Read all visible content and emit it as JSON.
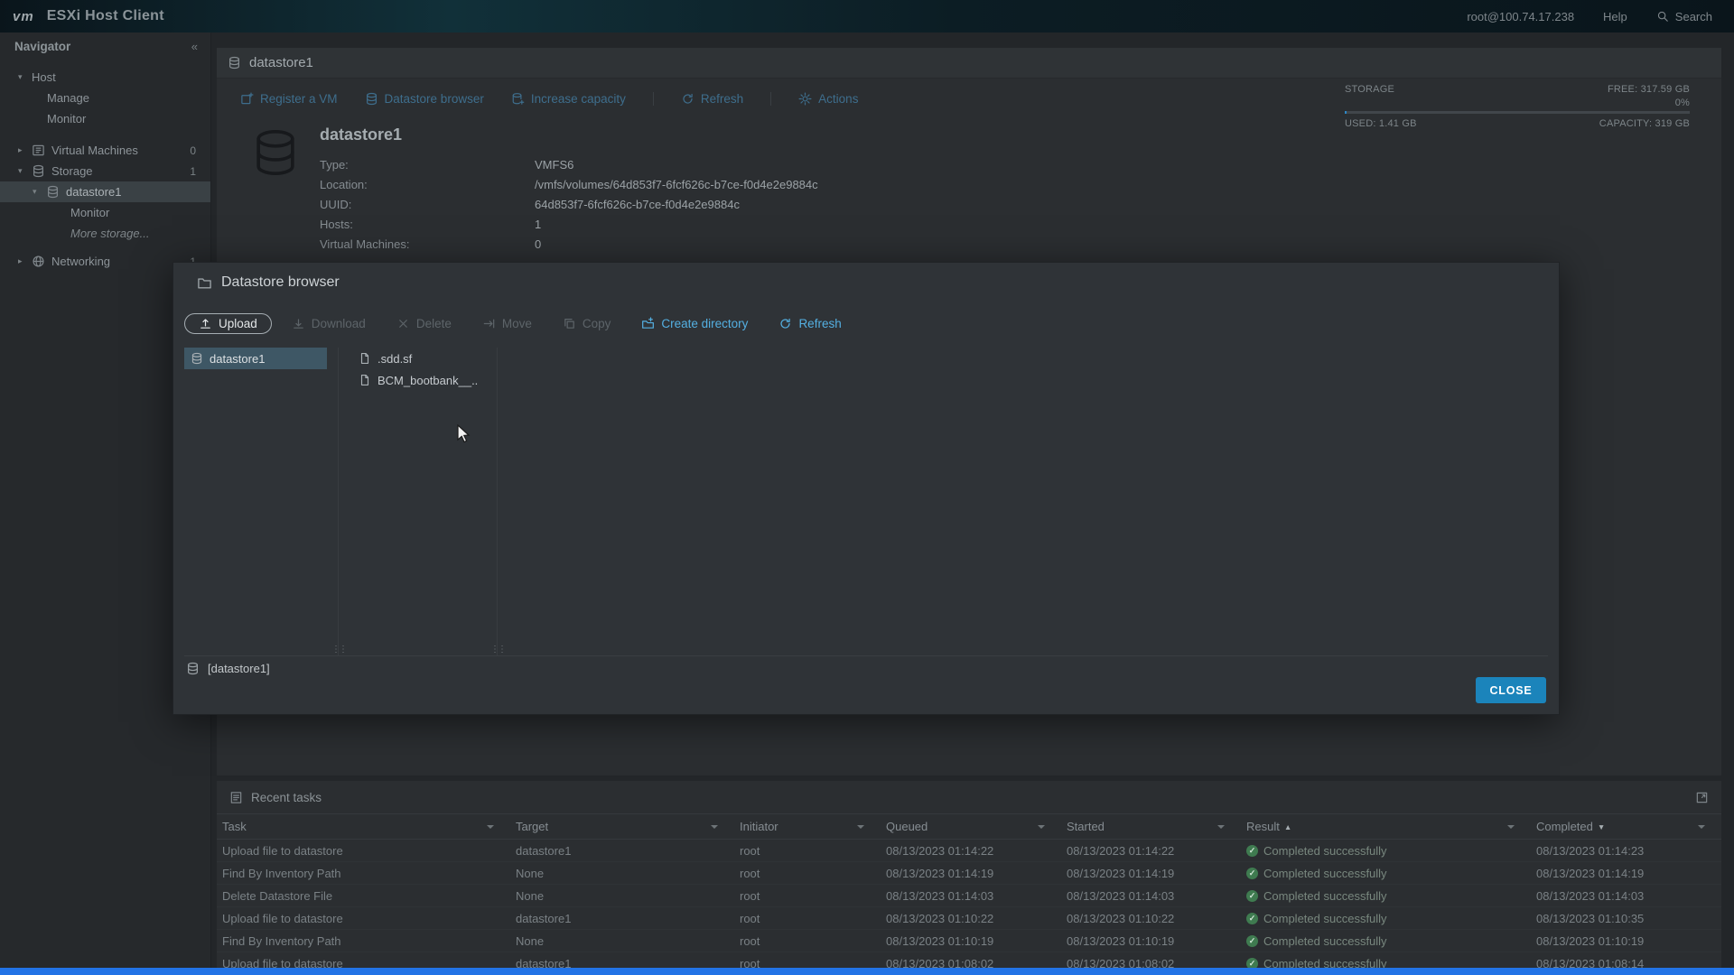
{
  "topbar": {
    "logo": "vm",
    "title": "ESXi Host Client",
    "user": "root@100.74.17.238",
    "help": "Help",
    "search": "Search"
  },
  "sidebar": {
    "header": "Navigator",
    "host": "Host",
    "manage": "Manage",
    "monitor": "Monitor",
    "virtual_machines": "Virtual Machines",
    "vm_count": "0",
    "storage": "Storage",
    "storage_count": "1",
    "datastore1": "datastore1",
    "datastore_monitor": "Monitor",
    "more_storage": "More storage...",
    "networking": "Networking",
    "networking_count": "1"
  },
  "main": {
    "title": "datastore1",
    "toolbar": {
      "register_vm": "Register a VM",
      "datastore_browser": "Datastore browser",
      "increase_capacity": "Increase capacity",
      "refresh": "Refresh",
      "actions": "Actions"
    },
    "storage_widget": {
      "label": "STORAGE",
      "free": "FREE: 317.59 GB",
      "percent": "0%",
      "used": "USED: 1.41 GB",
      "capacity": "CAPACITY: 319 GB"
    },
    "details": {
      "name": "datastore1",
      "type_label": "Type:",
      "type": "VMFS6",
      "location_label": "Location:",
      "location": "/vmfs/volumes/64d853f7-6fcf626c-b7ce-f0d4e2e9884c",
      "uuid_label": "UUID:",
      "uuid": "64d853f7-6fcf626c-b7ce-f0d4e2e9884c",
      "hosts_label": "Hosts:",
      "hosts": "1",
      "vms_label": "Virtual Machines:",
      "vms": "0"
    }
  },
  "modal": {
    "title": "Datastore browser",
    "toolbar": {
      "upload": "Upload",
      "download": "Download",
      "delete": "Delete",
      "move": "Move",
      "copy": "Copy",
      "create_directory": "Create directory",
      "refresh": "Refresh"
    },
    "datastores": [
      {
        "name": "datastore1"
      }
    ],
    "files": [
      {
        "name": ".sdd.sf"
      },
      {
        "name": "BCM_bootbank__.."
      }
    ],
    "status": "[datastore1]",
    "close": "CLOSE"
  },
  "tasks": {
    "title": "Recent tasks",
    "columns": [
      "Task",
      "Target",
      "Initiator",
      "Queued",
      "Started",
      "Result",
      "Completed"
    ],
    "sort_asc": "▲",
    "sort_desc": "▼",
    "rows": [
      {
        "task": "Upload file to datastore",
        "target": "datastore1",
        "initiator": "root",
        "queued": "08/13/2023 01:14:22",
        "started": "08/13/2023 01:14:22",
        "result": "Completed successfully",
        "completed": "08/13/2023 01:14:23"
      },
      {
        "task": "Find By Inventory Path",
        "target": "None",
        "initiator": "root",
        "queued": "08/13/2023 01:14:19",
        "started": "08/13/2023 01:14:19",
        "result": "Completed successfully",
        "completed": "08/13/2023 01:14:19"
      },
      {
        "task": "Delete Datastore File",
        "target": "None",
        "initiator": "root",
        "queued": "08/13/2023 01:14:03",
        "started": "08/13/2023 01:14:03",
        "result": "Completed successfully",
        "completed": "08/13/2023 01:14:03"
      },
      {
        "task": "Upload file to datastore",
        "target": "datastore1",
        "initiator": "root",
        "queued": "08/13/2023 01:10:22",
        "started": "08/13/2023 01:10:22",
        "result": "Completed successfully",
        "completed": "08/13/2023 01:10:35"
      },
      {
        "task": "Find By Inventory Path",
        "target": "None",
        "initiator": "root",
        "queued": "08/13/2023 01:10:19",
        "started": "08/13/2023 01:10:19",
        "result": "Completed successfully",
        "completed": "08/13/2023 01:10:19"
      },
      {
        "task": "Upload file to datastore",
        "target": "datastore1",
        "initiator": "root",
        "queued": "08/13/2023 01:08:02",
        "started": "08/13/2023 01:08:02",
        "result": "Completed successfully",
        "completed": "08/13/2023 01:08:14"
      }
    ]
  },
  "colors": {
    "accent_blue": "#54b0e2",
    "close_button_blue": "#1b84bb",
    "success_green": "#3f7b50",
    "selection_blue": "#3e5765",
    "taskbar_blue": "#2273e6"
  }
}
